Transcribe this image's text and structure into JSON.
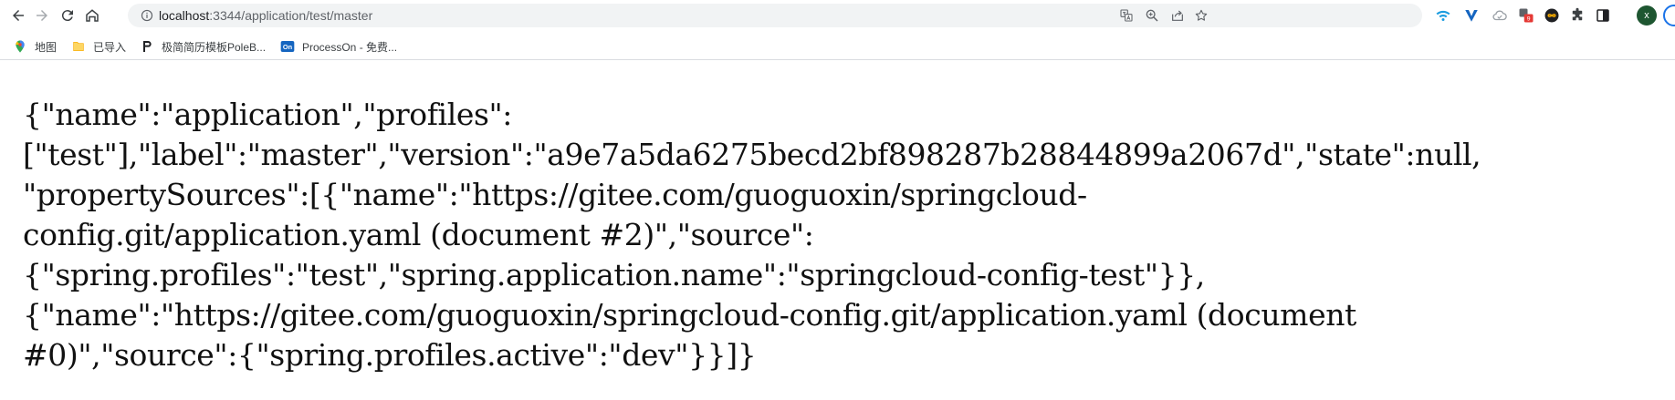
{
  "browser": {
    "url_host": "localhost",
    "url_rest": ":3344/application/test/master",
    "avatar_letter": "x",
    "icons": {
      "back": "back-arrow-icon",
      "forward": "forward-arrow-icon",
      "reload": "reload-icon",
      "home": "home-icon",
      "site_info": "info-icon",
      "translate": "translate-icon",
      "zoom": "zoom-icon",
      "share": "share-icon",
      "bookmark_star": "star-icon",
      "extensions": "puzzle-icon",
      "side_panel": "side-panel-icon"
    }
  },
  "bookmarks": [
    {
      "label": "地图",
      "icon": "map-pin-icon"
    },
    {
      "label": "已导入",
      "icon": "folder-icon"
    },
    {
      "label": "极简简历模板PoleB...",
      "icon": "pen-icon"
    },
    {
      "label": "ProcessOn - 免费...",
      "icon": "processon-icon"
    }
  ],
  "content": {
    "lines": [
      "{\"name\":\"application\",\"profiles\":",
      "[\"test\"],\"label\":\"master\",\"version\":\"a9e7a5da6275becd2bf898287b28844899a2067d\",\"state\":null,",
      "\"propertySources\":[{\"name\":\"https://gitee.com/guoguoxin/springcloud-",
      "config.git/application.yaml (document #2)\",\"source\":",
      "{\"spring.profiles\":\"test\",\"spring.application.name\":\"springcloud-config-test\"}},",
      "{\"name\":\"https://gitee.com/guoguoxin/springcloud-config.git/application.yaml (document",
      "#0)\",\"source\":{\"spring.profiles.active\":\"dev\"}}]}"
    ]
  },
  "colors": {
    "accent": "#1a73e8",
    "avatar_bg": "#1e5631"
  }
}
